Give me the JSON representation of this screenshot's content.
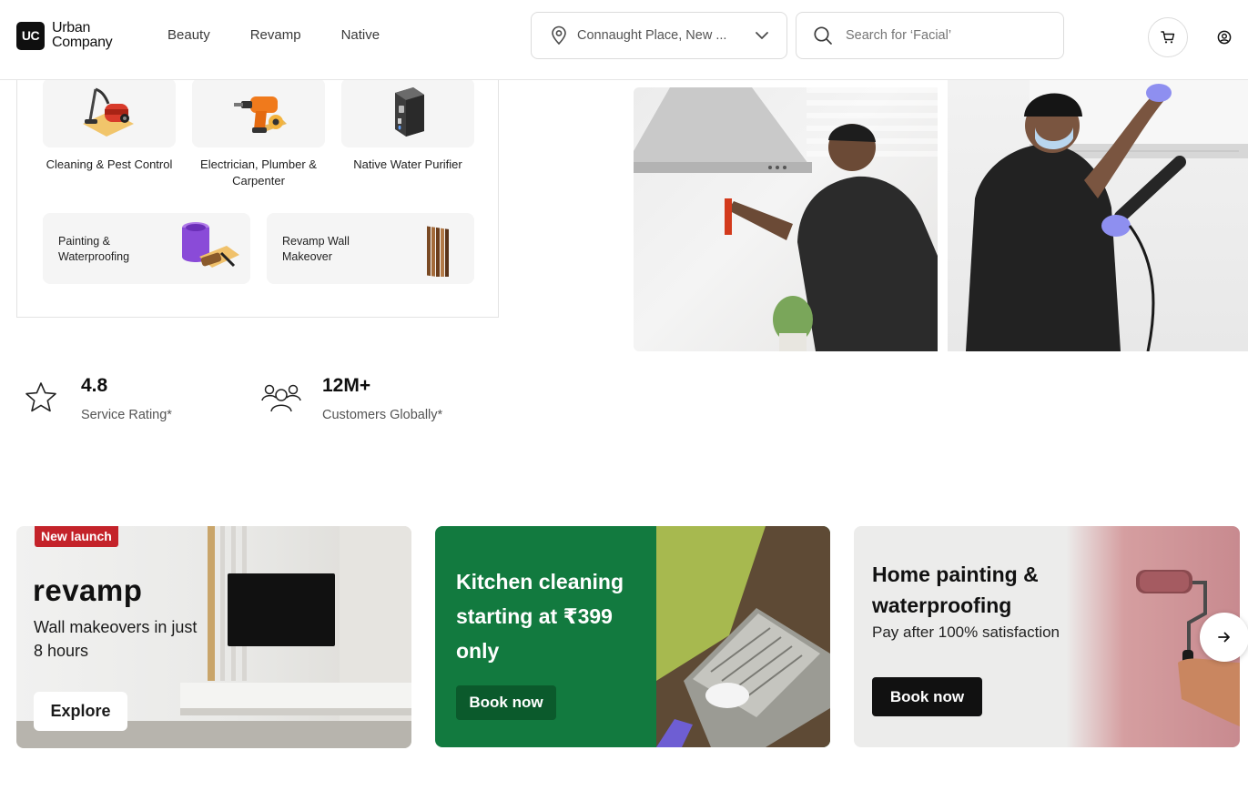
{
  "header": {
    "logo": {
      "line1": "Urban",
      "line2": "Company",
      "mark": "UC"
    },
    "nav": [
      "Beauty",
      "Revamp",
      "Native"
    ],
    "location": {
      "value": "Connaught Place, New ...",
      "icon": "location-pin-icon"
    },
    "search": {
      "placeholder": "Search for ‘Facial’",
      "icon": "search-icon"
    },
    "cart_icon": "cart-icon",
    "profile_icon": "profile-icon"
  },
  "categories": [
    {
      "label": "Cleaning & Pest Control",
      "icon": "vacuum-cleaner-icon"
    },
    {
      "label": "Electrician, Plumber & Carpenter",
      "icon": "drill-icon"
    },
    {
      "label": "Native Water Purifier",
      "icon": "water-purifier-icon"
    }
  ],
  "wide_categories": [
    {
      "label": "Painting & Waterproofing",
      "icon": "paint-bucket-icon"
    },
    {
      "label": "Revamp Wall Makeover",
      "icon": "wall-panel-icon"
    }
  ],
  "stats": [
    {
      "value": "4.8",
      "label": "Service Rating*",
      "icon": "star-icon"
    },
    {
      "value": "12M+",
      "label": "Customers Globally*",
      "icon": "customers-icon"
    }
  ],
  "banners": [
    {
      "badge": "New launch",
      "brand": "revamp",
      "headline": "Wall makeovers in just 8 hours",
      "cta": "Explore"
    },
    {
      "headline": "Kitchen cleaning starting at ₹399 only",
      "cta": "Book now",
      "color": "#127a3f"
    },
    {
      "headline": "Home painting & waterproofing",
      "subhead": "Pay after 100% satisfaction",
      "cta": "Book now"
    }
  ],
  "carousel_next_icon": "arrow-right-icon"
}
